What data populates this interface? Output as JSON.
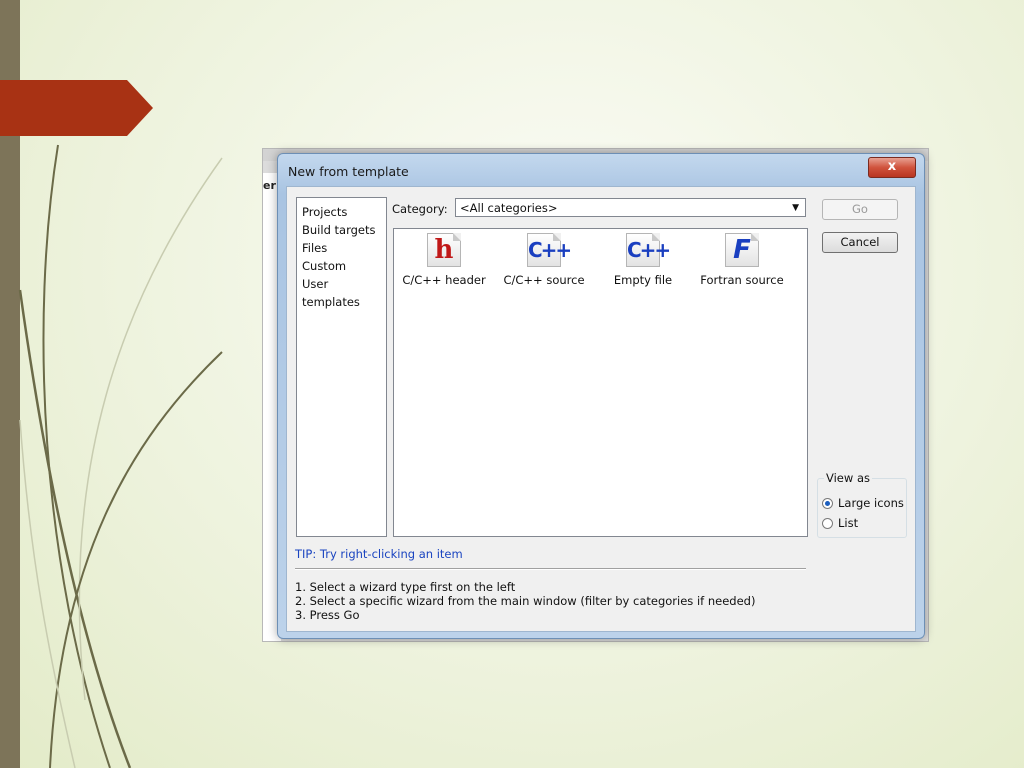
{
  "background_window": {
    "side_text": "er"
  },
  "dialog": {
    "title": "New from template",
    "close_label": "x"
  },
  "wizard_types": [
    "Projects",
    "Build targets",
    "Files",
    "Custom",
    "User templates"
  ],
  "category": {
    "label": "Category:",
    "selected": "<All categories>"
  },
  "templates": [
    {
      "glyph": "h",
      "label": "C/C++ header"
    },
    {
      "glyph": "C++",
      "label": "C/C++ source"
    },
    {
      "glyph": "C++",
      "label": "Empty file"
    },
    {
      "glyph": "F",
      "label": "Fortran source"
    }
  ],
  "buttons": {
    "go": "Go",
    "cancel": "Cancel"
  },
  "view_as": {
    "legend": "View as",
    "large_icons": "Large icons",
    "list": "List",
    "selected": "Large icons"
  },
  "tip": "TIP: Try right-clicking an item",
  "steps": [
    "1. Select a wizard type first on the left",
    "2. Select a specific wizard from the main window (filter by categories if needed)",
    "3. Press Go"
  ],
  "colors": {
    "accent_arrow": "#a83214",
    "slide_bar": "#7d7459",
    "tip_text": "#1a44c0",
    "header_icon": "#c01818",
    "source_icon": "#1a3fc0"
  }
}
